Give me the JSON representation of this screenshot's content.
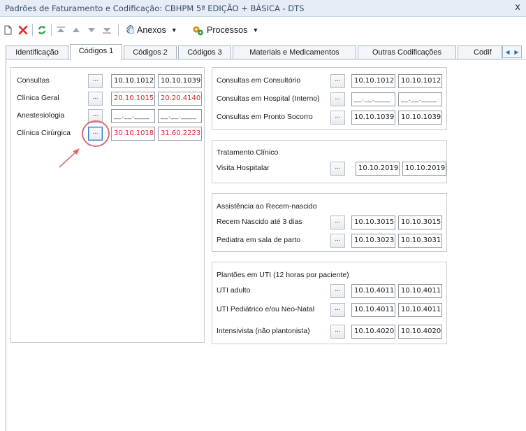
{
  "window": {
    "title": "Padrões de Faturamento e Codificação: CBHPM 5ª  EDIÇÃO + BÁSICA - DTS",
    "close_label": "x"
  },
  "toolbar": {
    "anexos_label": "Anexos",
    "processos_label": "Processos",
    "colors": {
      "delete": "#e0252b",
      "refresh": "#2e9a3a",
      "arrows": "#9aa4ae"
    }
  },
  "tabs": [
    "Identificação",
    "Códigos 1",
    "Códigos 2",
    "Códigos 3",
    "Materiais e Medicamentos",
    "Outras Codificações",
    "Codif"
  ],
  "active_tab": "Códigos 1",
  "left_panel": {
    "rows": [
      {
        "label": "Consultas",
        "btn": "...",
        "code1": "10.10.1012",
        "code2": "10.10.1039"
      },
      {
        "label": "Clínica Geral",
        "btn": "...",
        "code1": "20.10.1015",
        "code2": "20.20.4140"
      },
      {
        "label": "Anestesiologia",
        "btn": "...",
        "code1": "__.__.____",
        "code2": "__.__.____"
      },
      {
        "label": "Clínica Cirúrgica",
        "btn": "...",
        "code1": "30.10.1018",
        "code2": "31.60.2223"
      }
    ]
  },
  "consultas_panel": {
    "rows": [
      {
        "label": "Consultas em Consultório",
        "btn": "...",
        "code1": "10.10.1012",
        "code2": "10.10.1012"
      },
      {
        "label": "Consultas em Hospital (Interno)",
        "btn": "...",
        "code1": "__.__.____",
        "code2": "__.__.____"
      },
      {
        "label": "Consultas em Pronto Socorro",
        "btn": "...",
        "code1": "10.10.1039",
        "code2": "10.10.1039"
      }
    ]
  },
  "tratamento_panel": {
    "heading": "Tratamento Clínico",
    "rows": [
      {
        "label": "Visita Hospitalar",
        "btn": "...",
        "code1": "10.10.2019",
        "code2": "10.10.2019"
      }
    ]
  },
  "recem_panel": {
    "heading": "Assistência ao Recem-nascido",
    "rows": [
      {
        "label": "Recem Nascido até 3 dias",
        "btn": "...",
        "code1": "10.10.3015",
        "code2": "10.10.3015"
      },
      {
        "label": "Pediatra em sala de parto",
        "btn": "...",
        "code1": "10.10.3023",
        "code2": "10.10.3031"
      }
    ]
  },
  "uti_panel": {
    "heading": "Plantões em UTI (12 horas por paciente)",
    "rows": [
      {
        "label": "UTI adulto",
        "btn": "...",
        "code1": "10.10.4011",
        "code2": "10.10.4011"
      },
      {
        "label": "UTI Pediátrico e/ou Neo-Natal",
        "btn": "...",
        "code1": "10.10.4011",
        "code2": "10.10.4011"
      },
      {
        "label": "Intensivista (não plantonista)",
        "btn": "...",
        "code1": "10.10.4020",
        "code2": "10.10.4020"
      }
    ]
  },
  "code_colors": {
    "normal": "#1a1a1a",
    "highlight": "#e0252b"
  },
  "annotation": {
    "circle_color": "#e06a6a",
    "arrow_color": "#e06a6a"
  }
}
